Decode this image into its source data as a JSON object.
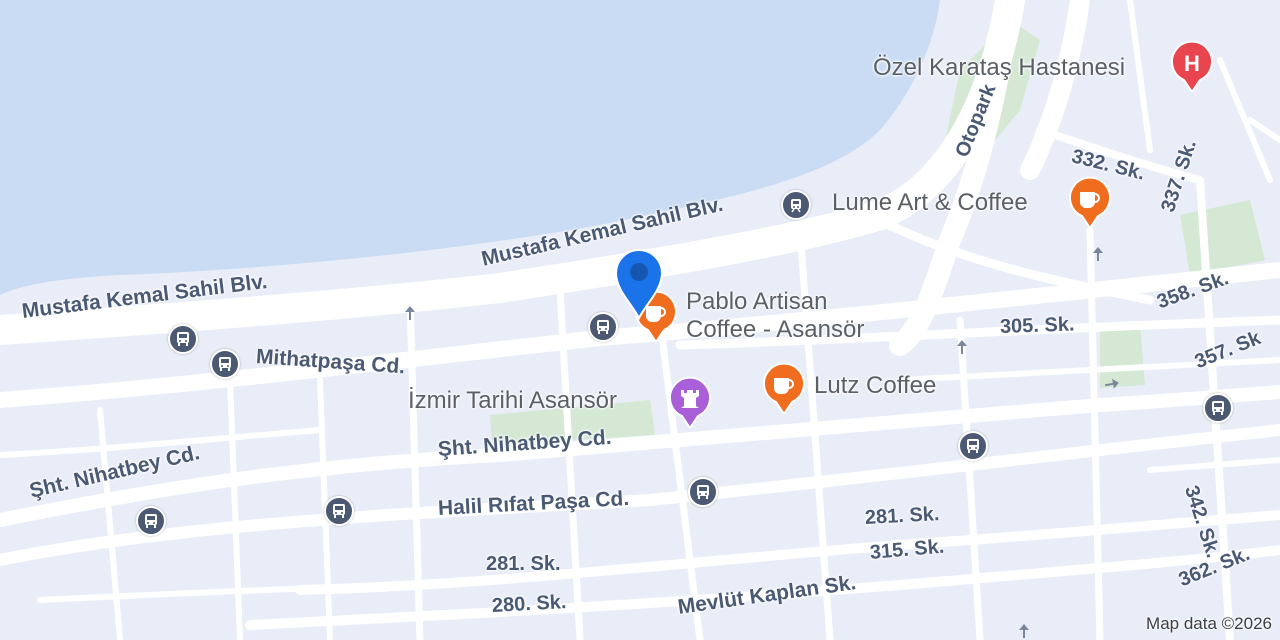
{
  "map": {
    "water_color": "#c9dcf3",
    "land_color": "#e9edf7",
    "road_color": "#ffffff",
    "park_color": "#d4e8d4"
  },
  "streets": {
    "sahil_left": "Mustafa Kemal Sahil Blv.",
    "sahil_right": "Mustafa Kemal Sahil Blv.",
    "mithatpasa": "Mithatpaşa Cd.",
    "nihatbey_left": "Şht. Nihatbey Cd.",
    "nihatbey_right": "Şht. Nihatbey Cd.",
    "halil": "Halil Rıfat Paşa Cd.",
    "s281_left": "281. Sk.",
    "s281_right": "281. Sk.",
    "s280": "280. Sk.",
    "s315": "315. Sk.",
    "mevlut": "Mevlüt Kaplan Sk.",
    "s305": "305. Sk.",
    "s358": "358. Sk.",
    "s357": "357. Sk",
    "s332": "332. Sk.",
    "s337": "337. Sk.",
    "s342": "342. Sk.",
    "s362": "362. Sk.",
    "otopark": "Otopark"
  },
  "pois": {
    "hospital": {
      "name": "Özel Karataş Hastanesi",
      "icon": "hospital-icon",
      "color": "#e8454f"
    },
    "lume": {
      "name": "Lume Art & Coffee",
      "icon": "coffee-icon",
      "color": "#f06d1f"
    },
    "pablo": {
      "name_line1": "Pablo Artisan",
      "name_line2": "Coffee - Asansör",
      "icon": "coffee-icon",
      "color": "#f06d1f"
    },
    "lutz": {
      "name": "Lutz Coffee",
      "icon": "coffee-icon",
      "color": "#f06d1f"
    },
    "asansor": {
      "name": "İzmir Tarihi Asansör",
      "icon": "landmark-icon",
      "color": "#a85fd8"
    }
  },
  "location_marker": {
    "color": "#1a73e8"
  },
  "attribution": "Map data ©2026"
}
